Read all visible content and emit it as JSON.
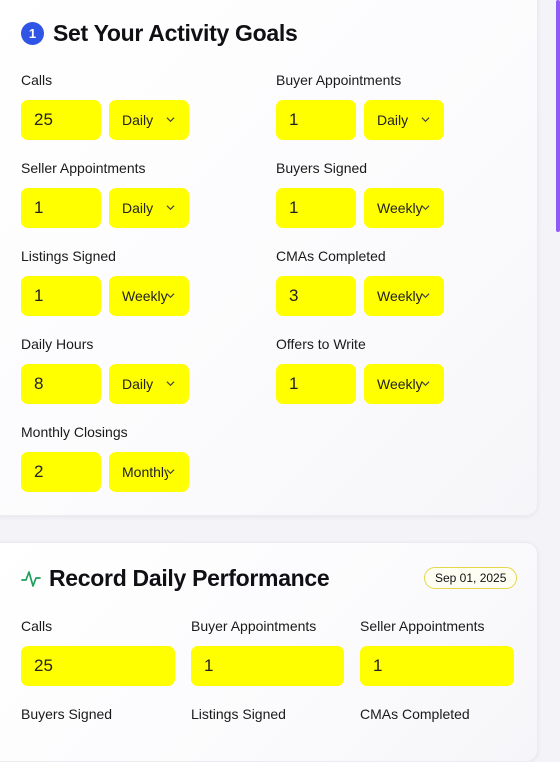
{
  "activity_goals": {
    "step_number": "1",
    "title": "Set Your Activity Goals",
    "fields": [
      {
        "label": "Calls",
        "value": "25",
        "period": "Daily"
      },
      {
        "label": "Buyer Appointments",
        "value": "1",
        "period": "Daily"
      },
      {
        "label": "Seller Appointments",
        "value": "1",
        "period": "Daily"
      },
      {
        "label": "Buyers Signed",
        "value": "1",
        "period": "Weekly"
      },
      {
        "label": "Listings Signed",
        "value": "1",
        "period": "Weekly"
      },
      {
        "label": "CMAs Completed",
        "value": "3",
        "period": "Weekly"
      },
      {
        "label": "Daily Hours",
        "value": "8",
        "period": "Daily"
      },
      {
        "label": "Offers to Write",
        "value": "1",
        "period": "Weekly"
      },
      {
        "label": "Monthly Closings",
        "value": "2",
        "period": "Monthly"
      }
    ]
  },
  "daily_performance": {
    "title": "Record Daily Performance",
    "date": "Sep 01, 2025",
    "fields": [
      {
        "label": "Calls",
        "value": "25"
      },
      {
        "label": "Buyer Appointments",
        "value": "1"
      },
      {
        "label": "Seller Appointments",
        "value": "1"
      },
      {
        "label": "Buyers Signed",
        "value": ""
      },
      {
        "label": "Listings Signed",
        "value": ""
      },
      {
        "label": "CMAs Completed",
        "value": ""
      }
    ]
  },
  "colors": {
    "input_highlight": "#ffff00",
    "badge_blue": "#2f54e6",
    "pulse_green": "#1e9e5a",
    "scrollbar": "#8f5cf5"
  },
  "icons": {
    "step_badge": "number-badge",
    "performance": "activity-pulse-icon",
    "dropdown": "chevron-down-icon"
  }
}
